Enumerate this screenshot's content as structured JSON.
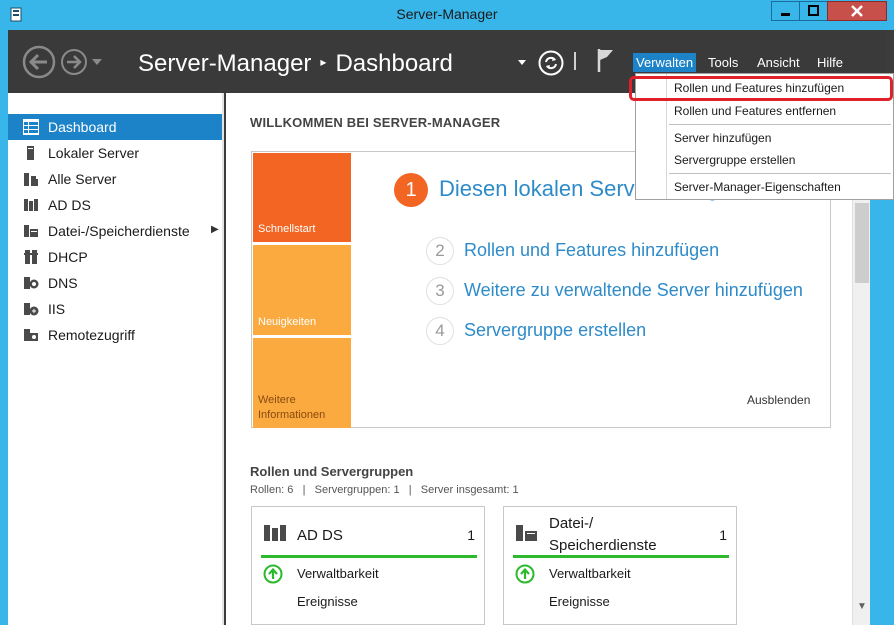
{
  "window": {
    "title": "Server-Manager"
  },
  "header": {
    "breadcrumb_app": "Server-Manager",
    "breadcrumb_sep": "▸",
    "breadcrumb_page": "Dashboard",
    "menus": [
      "Verwalten",
      "Tools",
      "Ansicht",
      "Hilfe"
    ]
  },
  "sidebar": {
    "items": [
      {
        "label": "Dashboard",
        "icon": "dashboard-icon",
        "active": true
      },
      {
        "label": "Lokaler Server",
        "icon": "server-icon"
      },
      {
        "label": "Alle Server",
        "icon": "servers-icon"
      },
      {
        "label": "AD DS",
        "icon": "adds-icon"
      },
      {
        "label": "Datei-/Speicherdienste",
        "icon": "storage-icon",
        "has_submenu": true
      },
      {
        "label": "DHCP",
        "icon": "dhcp-icon"
      },
      {
        "label": "DNS",
        "icon": "dns-icon"
      },
      {
        "label": "IIS",
        "icon": "iis-icon"
      },
      {
        "label": "Remotezugriff",
        "icon": "remote-access-icon"
      }
    ]
  },
  "welcome": {
    "title": "WILLKOMMEN BEI SERVER-MANAGER",
    "tiles": [
      "Schnellstart",
      "Neuigkeiten",
      "Weitere Informationen"
    ],
    "step1_num": "1",
    "step1_label": "Diesen lokalen Server konfigurieren",
    "steps": [
      {
        "num": "2",
        "label": "Rollen und Features hinzufügen"
      },
      {
        "num": "3",
        "label": "Weitere zu verwaltende Server hinzufügen"
      },
      {
        "num": "4",
        "label": "Servergruppe erstellen"
      }
    ],
    "hide_label": "Ausblenden"
  },
  "roles": {
    "title": "Rollen und Servergruppen",
    "stats": "Rollen: 6   |   Servergruppen: 1   |   Server insgesamt: 1",
    "cards": [
      {
        "title": "AD DS",
        "count": "1",
        "manage": "Verwaltbarkeit",
        "events": "Ereignisse"
      },
      {
        "title": "Datei-/ Speicherdienste",
        "count": "1",
        "manage": "Verwaltbarkeit",
        "events": "Ereignisse"
      }
    ]
  },
  "dropdown": {
    "items": [
      "Rollen und Features hinzufügen",
      "Rollen und Features entfernen",
      "Server hinzufügen",
      "Servergruppe erstellen",
      "Server-Manager-Eigenschaften"
    ]
  },
  "colors": {
    "titlebar": "#39b6e9",
    "header": "#3a3a3a",
    "accent": "#1c83c9",
    "orange": "#f26522",
    "light_orange": "#fbaa3f",
    "status_ok": "#2db92d",
    "highlight": "#e0202a"
  }
}
